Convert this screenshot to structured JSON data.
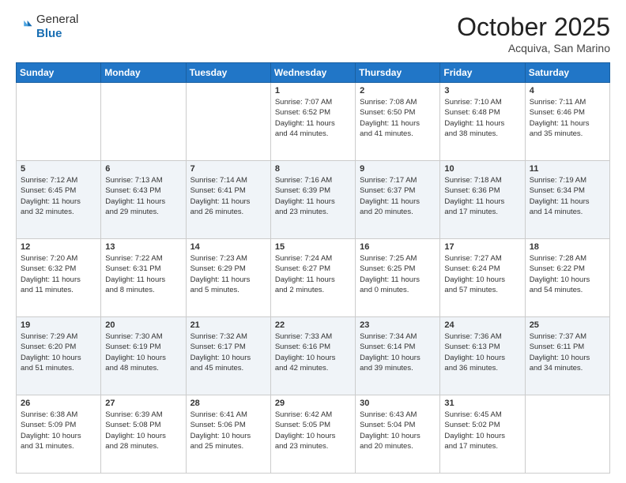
{
  "header": {
    "logo_line1": "General",
    "logo_line2": "Blue",
    "month": "October 2025",
    "location": "Acquiva, San Marino"
  },
  "weekdays": [
    "Sunday",
    "Monday",
    "Tuesday",
    "Wednesday",
    "Thursday",
    "Friday",
    "Saturday"
  ],
  "weeks": [
    [
      {
        "day": "",
        "info": ""
      },
      {
        "day": "",
        "info": ""
      },
      {
        "day": "",
        "info": ""
      },
      {
        "day": "1",
        "info": "Sunrise: 7:07 AM\nSunset: 6:52 PM\nDaylight: 11 hours\nand 44 minutes."
      },
      {
        "day": "2",
        "info": "Sunrise: 7:08 AM\nSunset: 6:50 PM\nDaylight: 11 hours\nand 41 minutes."
      },
      {
        "day": "3",
        "info": "Sunrise: 7:10 AM\nSunset: 6:48 PM\nDaylight: 11 hours\nand 38 minutes."
      },
      {
        "day": "4",
        "info": "Sunrise: 7:11 AM\nSunset: 6:46 PM\nDaylight: 11 hours\nand 35 minutes."
      }
    ],
    [
      {
        "day": "5",
        "info": "Sunrise: 7:12 AM\nSunset: 6:45 PM\nDaylight: 11 hours\nand 32 minutes."
      },
      {
        "day": "6",
        "info": "Sunrise: 7:13 AM\nSunset: 6:43 PM\nDaylight: 11 hours\nand 29 minutes."
      },
      {
        "day": "7",
        "info": "Sunrise: 7:14 AM\nSunset: 6:41 PM\nDaylight: 11 hours\nand 26 minutes."
      },
      {
        "day": "8",
        "info": "Sunrise: 7:16 AM\nSunset: 6:39 PM\nDaylight: 11 hours\nand 23 minutes."
      },
      {
        "day": "9",
        "info": "Sunrise: 7:17 AM\nSunset: 6:37 PM\nDaylight: 11 hours\nand 20 minutes."
      },
      {
        "day": "10",
        "info": "Sunrise: 7:18 AM\nSunset: 6:36 PM\nDaylight: 11 hours\nand 17 minutes."
      },
      {
        "day": "11",
        "info": "Sunrise: 7:19 AM\nSunset: 6:34 PM\nDaylight: 11 hours\nand 14 minutes."
      }
    ],
    [
      {
        "day": "12",
        "info": "Sunrise: 7:20 AM\nSunset: 6:32 PM\nDaylight: 11 hours\nand 11 minutes."
      },
      {
        "day": "13",
        "info": "Sunrise: 7:22 AM\nSunset: 6:31 PM\nDaylight: 11 hours\nand 8 minutes."
      },
      {
        "day": "14",
        "info": "Sunrise: 7:23 AM\nSunset: 6:29 PM\nDaylight: 11 hours\nand 5 minutes."
      },
      {
        "day": "15",
        "info": "Sunrise: 7:24 AM\nSunset: 6:27 PM\nDaylight: 11 hours\nand 2 minutes."
      },
      {
        "day": "16",
        "info": "Sunrise: 7:25 AM\nSunset: 6:25 PM\nDaylight: 11 hours\nand 0 minutes."
      },
      {
        "day": "17",
        "info": "Sunrise: 7:27 AM\nSunset: 6:24 PM\nDaylight: 10 hours\nand 57 minutes."
      },
      {
        "day": "18",
        "info": "Sunrise: 7:28 AM\nSunset: 6:22 PM\nDaylight: 10 hours\nand 54 minutes."
      }
    ],
    [
      {
        "day": "19",
        "info": "Sunrise: 7:29 AM\nSunset: 6:20 PM\nDaylight: 10 hours\nand 51 minutes."
      },
      {
        "day": "20",
        "info": "Sunrise: 7:30 AM\nSunset: 6:19 PM\nDaylight: 10 hours\nand 48 minutes."
      },
      {
        "day": "21",
        "info": "Sunrise: 7:32 AM\nSunset: 6:17 PM\nDaylight: 10 hours\nand 45 minutes."
      },
      {
        "day": "22",
        "info": "Sunrise: 7:33 AM\nSunset: 6:16 PM\nDaylight: 10 hours\nand 42 minutes."
      },
      {
        "day": "23",
        "info": "Sunrise: 7:34 AM\nSunset: 6:14 PM\nDaylight: 10 hours\nand 39 minutes."
      },
      {
        "day": "24",
        "info": "Sunrise: 7:36 AM\nSunset: 6:13 PM\nDaylight: 10 hours\nand 36 minutes."
      },
      {
        "day": "25",
        "info": "Sunrise: 7:37 AM\nSunset: 6:11 PM\nDaylight: 10 hours\nand 34 minutes."
      }
    ],
    [
      {
        "day": "26",
        "info": "Sunrise: 6:38 AM\nSunset: 5:09 PM\nDaylight: 10 hours\nand 31 minutes."
      },
      {
        "day": "27",
        "info": "Sunrise: 6:39 AM\nSunset: 5:08 PM\nDaylight: 10 hours\nand 28 minutes."
      },
      {
        "day": "28",
        "info": "Sunrise: 6:41 AM\nSunset: 5:06 PM\nDaylight: 10 hours\nand 25 minutes."
      },
      {
        "day": "29",
        "info": "Sunrise: 6:42 AM\nSunset: 5:05 PM\nDaylight: 10 hours\nand 23 minutes."
      },
      {
        "day": "30",
        "info": "Sunrise: 6:43 AM\nSunset: 5:04 PM\nDaylight: 10 hours\nand 20 minutes."
      },
      {
        "day": "31",
        "info": "Sunrise: 6:45 AM\nSunset: 5:02 PM\nDaylight: 10 hours\nand 17 minutes."
      },
      {
        "day": "",
        "info": ""
      }
    ]
  ]
}
